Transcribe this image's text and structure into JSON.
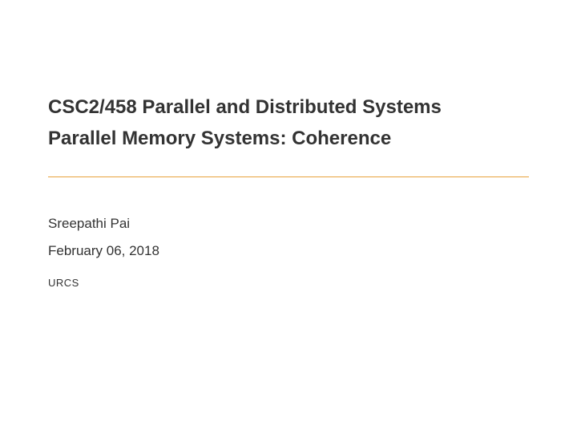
{
  "slide": {
    "title_line1": "CSC2/458 Parallel and Distributed Systems",
    "title_line2": "Parallel Memory Systems: Coherence",
    "author": "Sreepathi Pai",
    "date": "February 06, 2018",
    "institution": "URCS"
  }
}
